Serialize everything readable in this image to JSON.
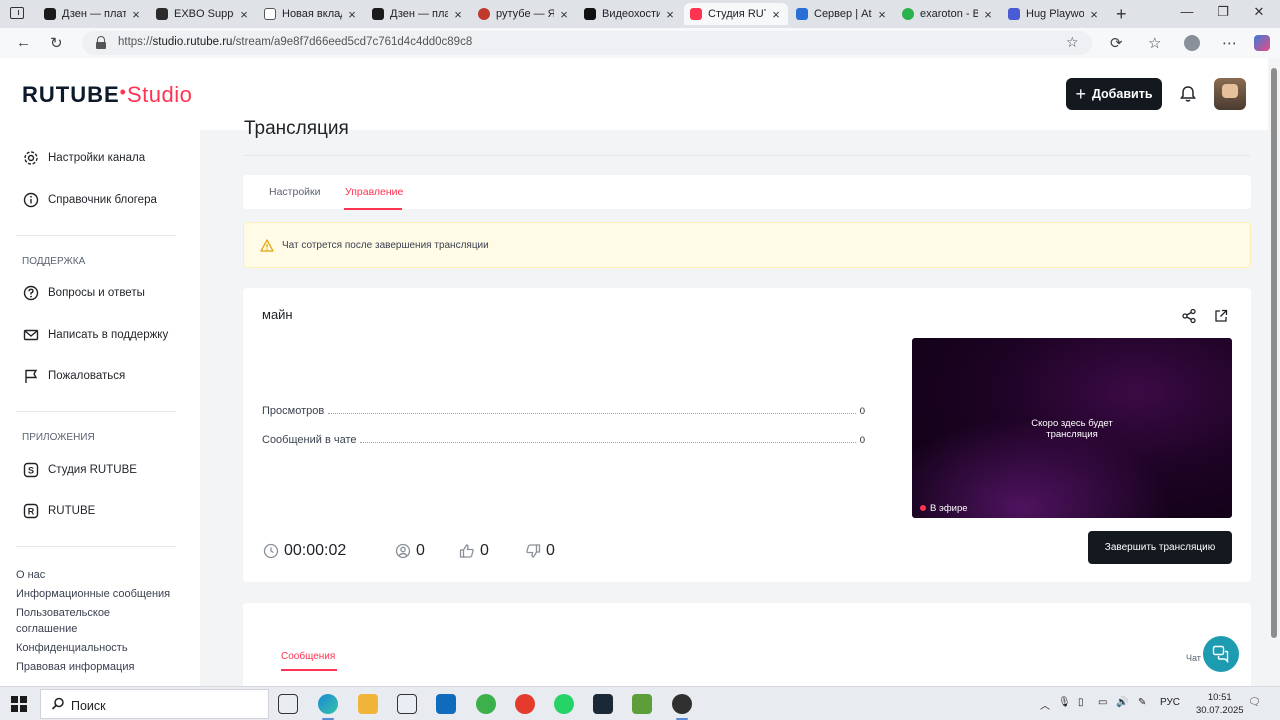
{
  "browser": {
    "tabs": [
      {
        "label": "Дзен — плат",
        "color": "#1b1b1b"
      },
      {
        "label": "EXBO Suppor",
        "color": "#2b2b2b"
      },
      {
        "label": "Новая вклад",
        "color": "#555555"
      },
      {
        "label": "Дзен — плат",
        "color": "#1b1b1b"
      },
      {
        "label": "рутубе — Ян",
        "color": "#c0392b"
      },
      {
        "label": "Видеохостин",
        "color": "#111111"
      },
      {
        "label": "Студия RUTU",
        "color": "#ff3352"
      },
      {
        "label": "Сервер | Ate",
        "color": "#2a6fd6"
      },
      {
        "label": "exaroton - Ba",
        "color": "#2bb24c"
      },
      {
        "label": "Hug Playwork",
        "color": "#4a5bd6"
      }
    ],
    "url_prefix": "https://",
    "url_domain": "studio.rutube.ru",
    "url_path": "/stream/a9e8f7d66eed5cd7c761d4c4dd0c89c8"
  },
  "header": {
    "logo_main": "RUTUBE",
    "logo_studio": "Studio",
    "add_label": "Добавить"
  },
  "sidebar": {
    "items": [
      {
        "label": "Настройки канала"
      },
      {
        "label": "Справочник блогера"
      }
    ],
    "support_title": "ПОДДЕРЖКА",
    "support_items": [
      {
        "label": "Вопросы и ответы"
      },
      {
        "label": "Написать в поддержку"
      },
      {
        "label": "Пожаловаться"
      }
    ],
    "apps_title": "ПРИЛОЖЕНИЯ",
    "apps_items": [
      {
        "label": "Студия RUTUBE"
      },
      {
        "label": "RUTUBE"
      }
    ],
    "footer_links": [
      "О нас",
      "Информационные сообщения",
      "Пользовательское соглашение",
      "Конфиденциальность",
      "Правовая информация"
    ]
  },
  "main": {
    "title": "Трансляция",
    "tabs": [
      {
        "label": "Настройки",
        "active": false
      },
      {
        "label": "Управление",
        "active": true
      }
    ],
    "warning": "Чат сотрется после завершения трансляции",
    "stream": {
      "name": "майн",
      "stats": [
        {
          "label": "Просмотров",
          "value": "0"
        },
        {
          "label": "Сообщений в чате",
          "value": "0"
        }
      ],
      "preview_text_1": "Скоро здесь будет",
      "preview_text_2": "трансляция",
      "live_label": "В эфире",
      "duration": "00:00:02",
      "viewers": "0",
      "likes": "0",
      "dislikes": "0",
      "end_label": "Завершить трансляцию"
    },
    "messages_tab": "Сообщения",
    "chat_label": "Чат"
  },
  "taskbar": {
    "search_label": "Поиск",
    "lang": "РУС",
    "time": "10:51",
    "date": "30.07.2025"
  },
  "colors": {
    "accent": "#ff3352",
    "dark_button": "#14191f",
    "warning_bg": "#fffbe6",
    "help_button": "#1d9bb0"
  }
}
